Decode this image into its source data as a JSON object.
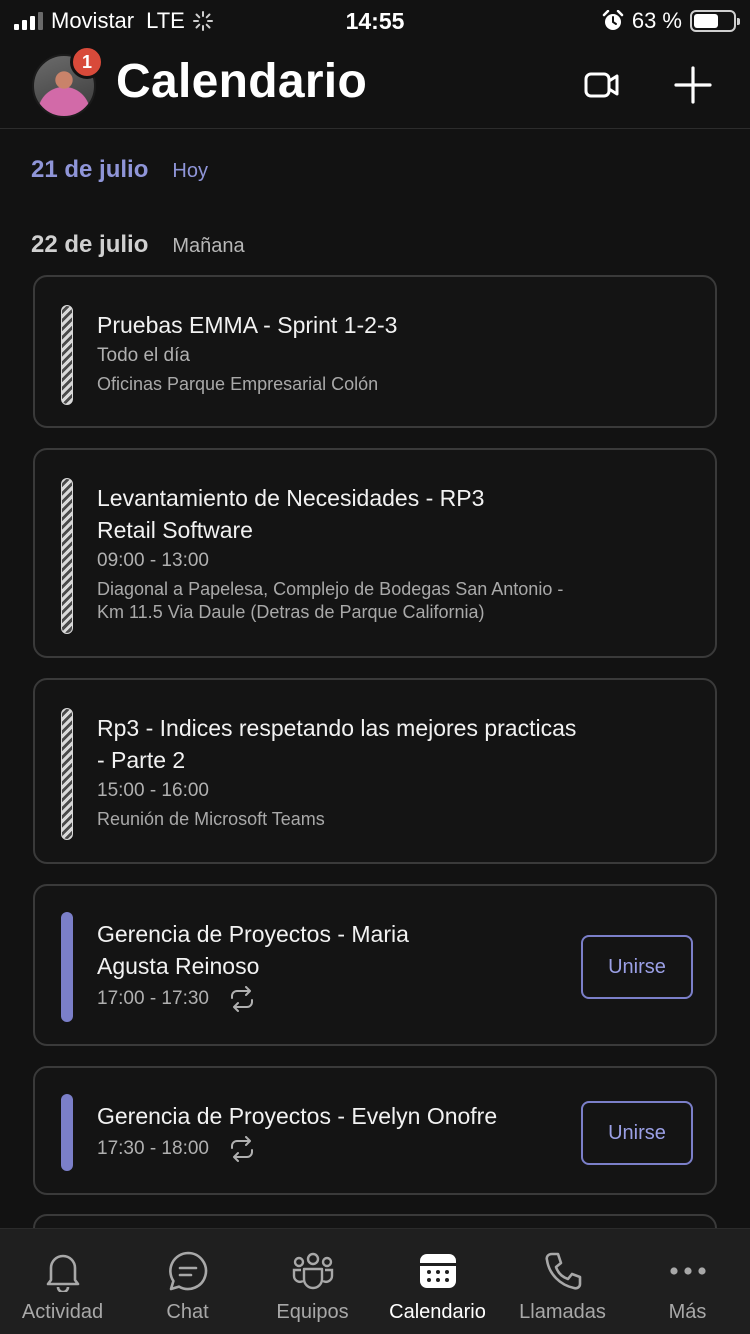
{
  "status_bar": {
    "carrier": "Movistar",
    "network": "LTE",
    "time": "14:55",
    "battery": "63 %",
    "battery_level": 0.63,
    "icons": [
      "signal-icon",
      "loading-spinner-icon",
      "alarm-icon",
      "battery-icon"
    ]
  },
  "header": {
    "title": "Calendario",
    "notification_count": "1",
    "actions": [
      "video-meeting-icon",
      "add-icon"
    ]
  },
  "dates": {
    "today": {
      "date": "21 de julio",
      "label": "Hoy"
    },
    "tomorrow": {
      "date": "22 de julio",
      "label": "Mañana"
    }
  },
  "events": [
    {
      "title": "Pruebas EMMA - Sprint 1-2-3",
      "time": "Todo el día",
      "location": "Oficinas Parque Empresarial Colón"
    },
    {
      "title_lines": [
        "Levantamiento de Necesidades - RP3",
        "Retail Software"
      ],
      "time": "09:00 - 13:00",
      "location_lines": [
        "Diagonal a Papelesa, Complejo de Bodegas San Antonio -",
        "Km 11.5 Via Daule (Detras de Parque California)"
      ]
    },
    {
      "title_lines": [
        "Rp3 - Indices respetando las mejores practicas",
        "- Parte 2"
      ],
      "time": "15:00 - 16:00",
      "location": "Reunión de Microsoft Teams"
    },
    {
      "title_lines": [
        "Gerencia de Proyectos - Maria",
        "Agusta Reinoso"
      ],
      "time": "17:00 - 17:30",
      "join_label": "Unirse"
    },
    {
      "title": "Gerencia de Proyectos - Evelyn Onofre",
      "time": "17:30 - 18:00",
      "join_label": "Unirse"
    }
  ],
  "tabs": [
    {
      "label": "Actividad",
      "icon": "bell-icon"
    },
    {
      "label": "Chat",
      "icon": "chat-icon"
    },
    {
      "label": "Equipos",
      "icon": "teams-icon"
    },
    {
      "label": "Calendario",
      "icon": "calendar-icon",
      "active": true
    },
    {
      "label": "Llamadas",
      "icon": "phone-icon"
    },
    {
      "label": "Más",
      "icon": "more-icon"
    }
  ],
  "colors": {
    "accent": "#7b7fc9",
    "today_text": "#8f95d8",
    "background": "#121212",
    "badge": "#d84a3a"
  }
}
